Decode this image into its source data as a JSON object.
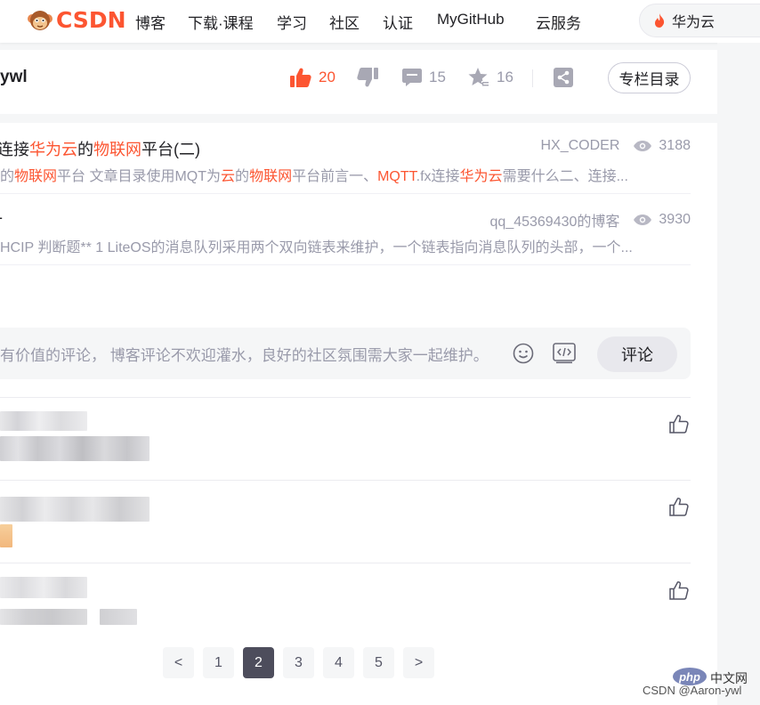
{
  "header": {
    "logo_text": "CSDN",
    "nav": [
      "博客",
      "下载·课程",
      "学习",
      "社区",
      "认证",
      "MyGitHub",
      "云服务"
    ],
    "search_value": "华为云"
  },
  "article_bar": {
    "author": "ywl",
    "likes": "20",
    "comments": "15",
    "favorites": "16",
    "catalog_label": "专栏目录"
  },
  "recommendations": [
    {
      "title_parts": [
        {
          "text": "连接",
          "hl": false
        },
        {
          "text": "华为云",
          "hl": true
        },
        {
          "text": "的",
          "hl": false
        },
        {
          "text": "物联网",
          "hl": true
        },
        {
          "text": "平台(二)",
          "hl": false
        }
      ],
      "author": "HX_CODER",
      "views": "3188",
      "desc_parts": [
        {
          "text": "的",
          "hl": false
        },
        {
          "text": "物联网",
          "hl": true
        },
        {
          "text": "平台 文章目录使用MQT为",
          "hl": false
        },
        {
          "text": "云",
          "hl": true
        },
        {
          "text": "的",
          "hl": false
        },
        {
          "text": "物联网",
          "hl": true
        },
        {
          "text": "平台前言一、",
          "hl": false
        },
        {
          "text": "MQTT",
          "hl": true
        },
        {
          "text": ".fx连接",
          "hl": false
        },
        {
          "text": "华为云",
          "hl": true
        },
        {
          "text": "需要什么二、连接...",
          "hl": false
        }
      ]
    },
    {
      "title_parts": [
        {
          "text": "-",
          "hl": false
        }
      ],
      "author": "qq_45369430的博客",
      "views": "3930",
      "desc_parts": [
        {
          "text": "HCIP 判断题** 1 LiteOS的消息队列采用两个双向链表来维护，一个链表指向消息队列的头部，一个...",
          "hl": false
        }
      ]
    }
  ],
  "comment_form": {
    "placeholder": "有价值的评论， 博客评论不欢迎灌水，良好的社区氛围需大家一起维护。",
    "submit_label": "评论"
  },
  "pagination": {
    "prev": "<",
    "pages": [
      "1",
      "2",
      "3",
      "4",
      "5"
    ],
    "active": "2",
    "next": ">"
  },
  "watermark": {
    "badge": "php",
    "badge_cn": "中文网",
    "credit": "CSDN @Aaron-ywl"
  },
  "colors": {
    "accent": "#fc5531",
    "muted": "#999aaa",
    "text": "#222226"
  }
}
